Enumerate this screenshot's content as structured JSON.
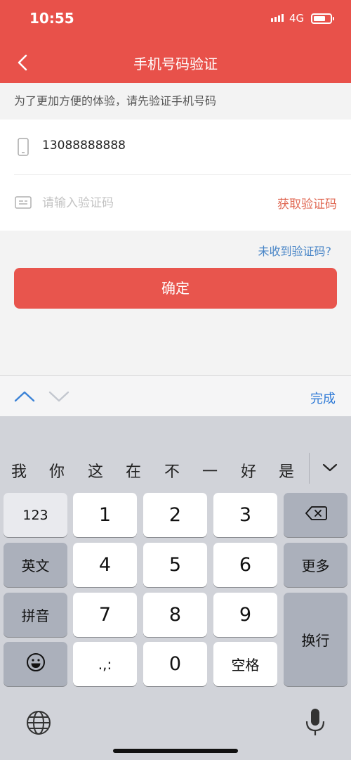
{
  "status": {
    "time": "10:55",
    "network": "4G"
  },
  "nav": {
    "title": "手机号码验证"
  },
  "hint": "为了更加方便的体验，请先验证手机号码",
  "form": {
    "phone_value": "13088888888",
    "code_placeholder": "请输入验证码",
    "get_code": "获取验证码"
  },
  "no_code_link": "未收到验证码?",
  "confirm_label": "确定",
  "accessory": {
    "done": "完成"
  },
  "keyboard": {
    "candidates": [
      "我",
      "你",
      "这",
      "在",
      "不",
      "一",
      "好",
      "是"
    ],
    "mode_123": "123",
    "english": "英文",
    "pinyin": "拼音",
    "more": "更多",
    "newline": "换行",
    "space": "空格",
    "punct": ".,:",
    "digits": [
      "1",
      "2",
      "3",
      "4",
      "5",
      "6",
      "7",
      "8",
      "9",
      "0"
    ]
  },
  "colors": {
    "brand": "#e8514a",
    "link": "#4a86c7",
    "get_code": "#e06a55",
    "done": "#2f7ad6"
  }
}
